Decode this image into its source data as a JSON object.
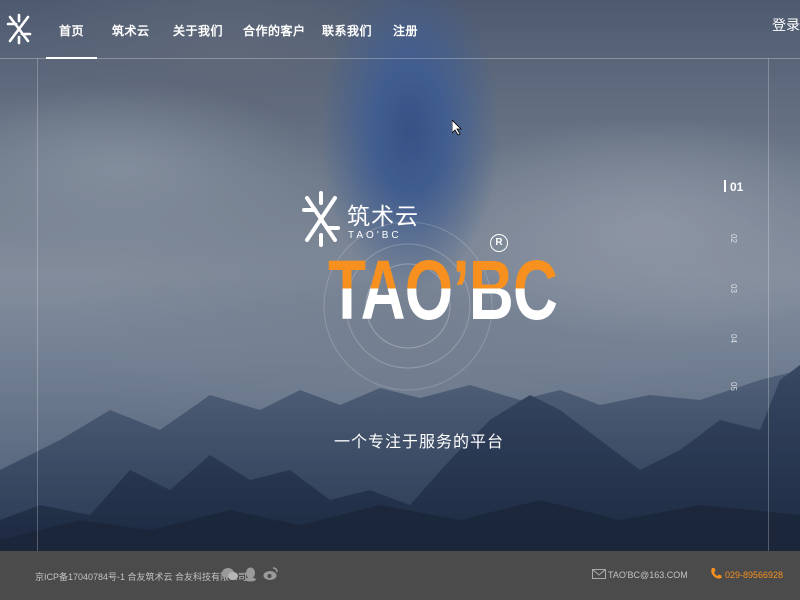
{
  "nav": {
    "items": [
      {
        "label": "首页",
        "active": true
      },
      {
        "label": "筑术云",
        "active": false
      },
      {
        "label": "关于我们",
        "active": false
      },
      {
        "label": "合作的客户",
        "active": false
      },
      {
        "label": "联系我们",
        "active": false
      },
      {
        "label": "注册",
        "active": false
      }
    ],
    "login_label": "登录"
  },
  "brand": {
    "name_cn": "筑术云",
    "name_en": "TAO'BC",
    "title": "TAO’BC",
    "registered_mark": "R",
    "slogan": "一个专注于服务的平台"
  },
  "pager": {
    "active": "01",
    "items": [
      "02",
      "03",
      "04",
      "05"
    ]
  },
  "footer": {
    "icp": "京ICP备17040784号-1 合友筑术云 合友科技有限公司",
    "email": "TAO'BC@163.COM",
    "phone": "029-89566928",
    "icons": [
      "wechat-icon",
      "qq-icon",
      "weibo-icon",
      "mail-icon",
      "phone-icon"
    ]
  },
  "colors": {
    "accent": "#f7901e",
    "footer_bg": "#4b4b4b",
    "text": "#ffffff"
  }
}
